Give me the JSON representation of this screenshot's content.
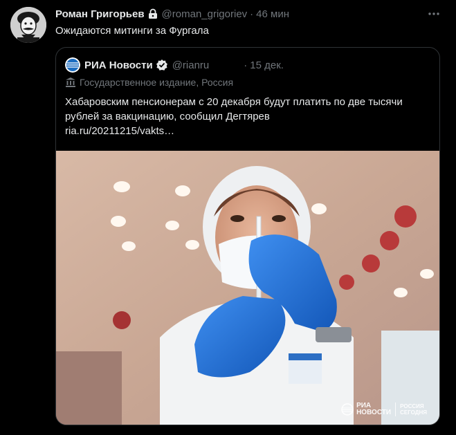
{
  "tweet": {
    "author_name": "Роман Григорьев",
    "author_handle": "@roman_grigoriev",
    "separator": "·",
    "time": "46 мин",
    "text": "Ожидаются митинги за Фургала",
    "icons": {
      "avatar": "caricature-avatar",
      "lock": "lock-icon",
      "more": "more-icon"
    }
  },
  "quote": {
    "author_name": "РИА Новости",
    "author_handle": "@rianru",
    "separator": "·",
    "time": "15 дек.",
    "label": "Государственное издание, Россия",
    "text": "Хабаровским пенсионерам с 20 декабря будут платить по две тысячи рублей за вакцинацию, сообщил Дегтярев",
    "link": "ria.ru/20211215/vakts…",
    "icons": {
      "avatar": "ria-logo",
      "verified": "verified-icon",
      "label": "building-icon"
    },
    "photo": {
      "watermark_line1": "РИА",
      "watermark_line2": "НОВОСТИ",
      "watermark_line3": "РОССИЯ",
      "watermark_line4": "СЕГОДНЯ"
    }
  },
  "colors": {
    "background": "#000000",
    "text": "#e7e9ea",
    "secondary": "#71767b",
    "border": "#2f3336",
    "glove": "#1e6fd6"
  }
}
